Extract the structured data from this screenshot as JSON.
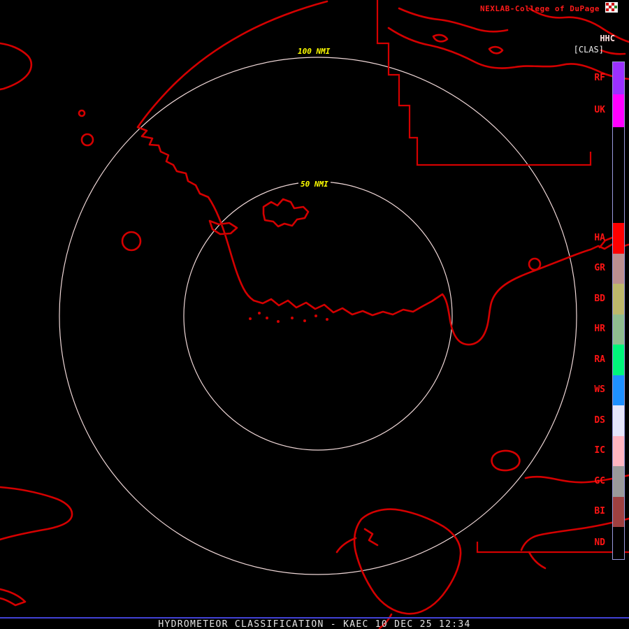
{
  "header": {
    "title": "NEXLAB-College of DuPage",
    "product_code": "HHC",
    "product_tag": "[CLAS]"
  },
  "map": {
    "outer_ring_label": "100 NMI",
    "inner_ring_label": "50 NMI"
  },
  "legend": {
    "items": [
      {
        "label": "RF",
        "color": "#9b30ff"
      },
      {
        "label": "UK",
        "color": "#ff00ff"
      },
      {
        "label": "HA",
        "color": "#ff0000"
      },
      {
        "label": "GR",
        "color": "#bc8f8f"
      },
      {
        "label": "BD",
        "color": "#bdb76b"
      },
      {
        "label": "HR",
        "color": "#8fbc8f"
      },
      {
        "label": "RA",
        "color": "#00f57a"
      },
      {
        "label": "WS",
        "color": "#1e90ff"
      },
      {
        "label": "DS",
        "color": "#e6e6fa"
      },
      {
        "label": "IC",
        "color": "#ffb6c1"
      },
      {
        "label": "GC",
        "color": "#9a9a9a"
      },
      {
        "label": "BI",
        "color": "#9e4040"
      },
      {
        "label": "ND",
        "color": "#000000"
      }
    ]
  },
  "footer": {
    "caption": "HYDROMETEOR CLASSIFICATION - KAEC 10 DEC 25 12:34"
  },
  "colors": {
    "coastline": "#d40000",
    "range_ring": "#f0d8d8",
    "ring_label": "#ffff00",
    "title": "#ff1a1a",
    "legend_label": "#ff1414",
    "footer_line": "#4242d6"
  }
}
